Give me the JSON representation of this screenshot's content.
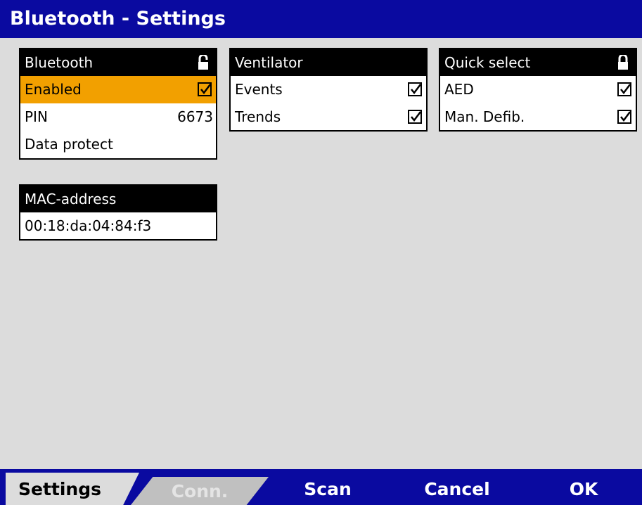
{
  "title": "Bluetooth - Settings",
  "bluetooth_panel": {
    "header": "Bluetooth",
    "rows": {
      "enabled": {
        "label": "Enabled",
        "checked": true
      },
      "pin": {
        "label": "PIN",
        "value": "6673"
      },
      "data_protect": {
        "label": "Data protect"
      }
    }
  },
  "ventilator_panel": {
    "header": "Ventilator",
    "rows": {
      "events": {
        "label": "Events",
        "checked": true
      },
      "trends": {
        "label": "Trends",
        "checked": true
      }
    }
  },
  "quick_select_panel": {
    "header": "Quick select",
    "rows": {
      "aed": {
        "label": "AED",
        "checked": true
      },
      "man_defib": {
        "label": "Man. Defib.",
        "checked": true
      }
    }
  },
  "mac_panel": {
    "header": "MAC-address",
    "value": "00:18:da:04:84:f3"
  },
  "bottom_bar": {
    "tab_settings": "Settings",
    "tab_conn": "Conn.",
    "scan": "Scan",
    "cancel": "Cancel",
    "ok": "OK"
  },
  "colors": {
    "title_bar": "#0a0aa0",
    "highlight": "#f2a000",
    "background": "#dcdcdc"
  },
  "icons": {
    "lock": "lock-icon",
    "checkbox": "checkmark-icon"
  }
}
